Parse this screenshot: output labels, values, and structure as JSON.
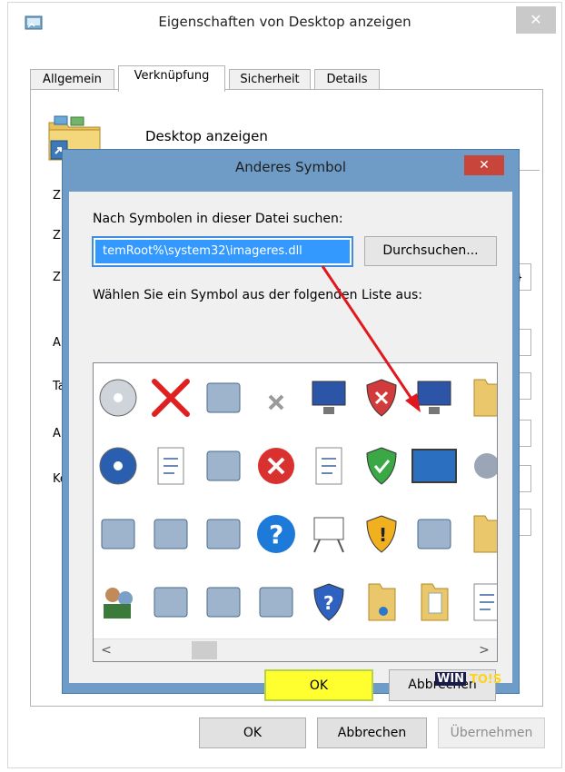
{
  "window": {
    "title": "Eigenschaften von Desktop anzeigen",
    "close_symbol": "✕"
  },
  "tabs": [
    {
      "label": "Allgemein"
    },
    {
      "label": "Verknüpfung"
    },
    {
      "label": "Sicherheit"
    },
    {
      "label": "Details"
    }
  ],
  "shortcut": {
    "name": "Desktop anzeigen",
    "icon": "folder-desktop-icon",
    "label_stubs": [
      "Zi",
      "Zi",
      "Zi",
      "Ar",
      "Ta",
      "Ar",
      "Ko"
    ],
    "field_stub": "}"
  },
  "dialog": {
    "title": "Anderes Symbol",
    "close_symbol": "✕",
    "search_label": "Nach Symbolen in dieser Datei suchen:",
    "path_value": "temRoot%\\system32\\imageres.dll",
    "browse_label": "Durchsuchen...",
    "list_label": "Wählen Sie ein Symbol aus der folgenden Liste aus:",
    "scroll_left": "<",
    "scroll_right": ">",
    "ok_label": "OK",
    "cancel_label": "Abbrechen",
    "icons": [
      [
        "cd-music-icon",
        "red-x-icon",
        "pda-icon",
        "grey-x-icon",
        "monitor-icon",
        "red-shield-icon",
        "computer-network-icon",
        "folder-icon"
      ],
      [
        "clock-disc-icon",
        "document-icon",
        "text-field-icon",
        "error-icon",
        "blank-page-icon",
        "green-shield-icon",
        "desktop-icon",
        "gear-icon"
      ],
      [
        "library-icon",
        "printer-disk-icon",
        "scanner-icon",
        "help-icon",
        "projector-icon",
        "warning-shield-icon",
        "programs-icon",
        "folder-icon"
      ],
      [
        "users-icon",
        "tablet-icon",
        "chip-icon",
        "network-frame-icon",
        "question-shield-icon",
        "music-folder-icon",
        "document-folder-icon",
        "list-icon"
      ]
    ]
  },
  "footer": {
    "ok_label": "OK",
    "cancel_label": "Abbrechen",
    "apply_label": "Übernehmen"
  },
  "watermark": {
    "w": "WIN",
    "t": "TO!S"
  },
  "colors": {
    "dialog_frame": "#6e9cc7",
    "highlight": "#3399ff",
    "ok_highlight": "#ffff30",
    "annotation_arrow": "#e0191f"
  }
}
